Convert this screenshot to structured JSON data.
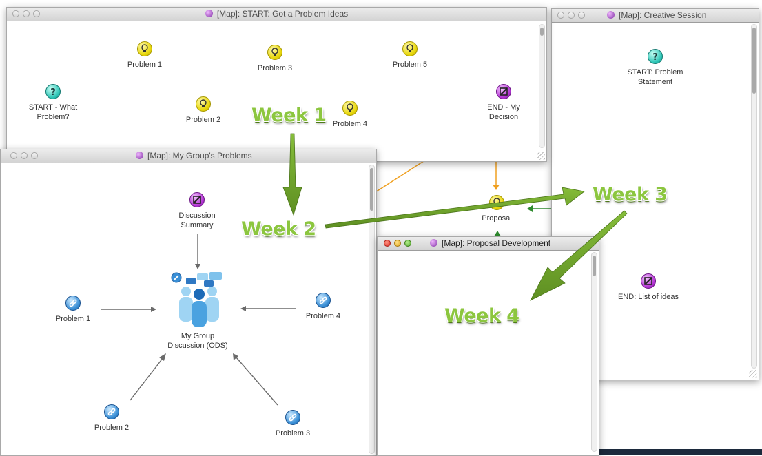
{
  "colors": {
    "week_arrow": "#72a82a",
    "week_text": "#8cc63f",
    "link_orange": "#f0a020",
    "link_green": "#2e8b2e",
    "link_gray": "#6a6a6a"
  },
  "windows": {
    "problem_ideas": {
      "title": "[Map]: START: Got a Problem Ideas",
      "nodes": {
        "p1": {
          "label": "Problem 1",
          "icon": "idea-icon"
        },
        "p3": {
          "label": "Problem 3",
          "icon": "idea-icon"
        },
        "p5": {
          "label": "Problem 5",
          "icon": "idea-icon"
        },
        "start": {
          "label": "START - What Problem?",
          "icon": "question-icon"
        },
        "p2": {
          "label": "Problem 2",
          "icon": "idea-icon"
        },
        "p4": {
          "label": "Problem 4",
          "icon": "idea-icon"
        },
        "end": {
          "label": "END - My Decision",
          "icon": "decision-icon"
        }
      }
    },
    "creative_session": {
      "title": "[Map]: Creative Session",
      "nodes": {
        "start": {
          "label": "START: Problem Statement",
          "icon": "question-icon"
        },
        "end": {
          "label": "END: List of ideas",
          "icon": "decision-icon"
        }
      }
    },
    "group_problems": {
      "title": "[Map]: My Group's Problems",
      "nodes": {
        "summary": {
          "label": "Discussion Summary",
          "icon": "decision-icon"
        },
        "discussion": {
          "label": "My Group Discussion (ODS)",
          "icon": "group-discussion-icon"
        },
        "p1": {
          "label": "Problem 1",
          "icon": "link-icon"
        },
        "p4": {
          "label": "Problem 4",
          "icon": "link-icon"
        },
        "p2": {
          "label": "Problem 2",
          "icon": "link-icon"
        },
        "p3": {
          "label": "Problem 3",
          "icon": "link-icon"
        }
      }
    },
    "proposal_dev": {
      "title": "[Map]: Proposal Development"
    }
  },
  "background_node": {
    "label": "Proposal",
    "icon": "idea-icon"
  },
  "weeks": {
    "w1": "Week 1",
    "w2": "Week 2",
    "w3": "Week 3",
    "w4": "Week 4"
  }
}
